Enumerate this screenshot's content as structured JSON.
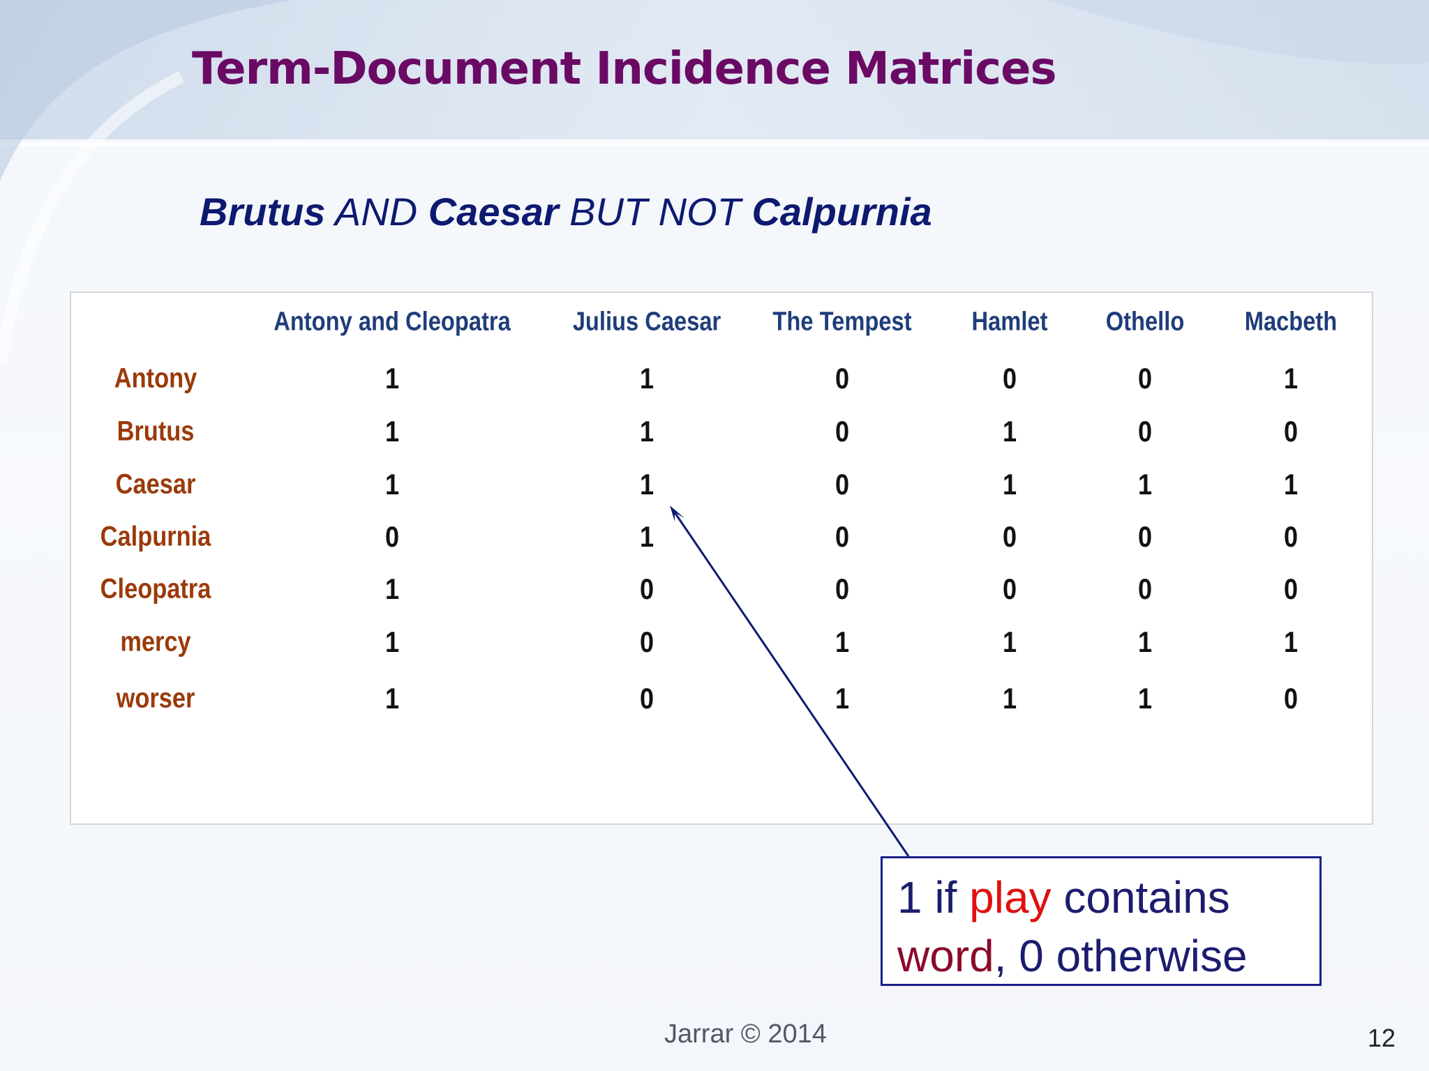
{
  "slide": {
    "title": "Term-Document Incidence Matrices",
    "query": {
      "parts": [
        {
          "text": "Brutus",
          "bold": true
        },
        {
          "text": " AND ",
          "bold": false
        },
        {
          "text": "Caesar",
          "bold": true
        },
        {
          "text": " BUT NOT ",
          "bold": false
        },
        {
          "text": "Calpurnia",
          "bold": true
        }
      ]
    },
    "matrix": {
      "columns": [
        "Antony and Cleopatra",
        "Julius Caesar",
        "The Tempest",
        "Hamlet",
        "Othello",
        "Macbeth"
      ],
      "rows": [
        {
          "term": "Antony",
          "values": [
            "1",
            "1",
            "0",
            "0",
            "0",
            "1"
          ]
        },
        {
          "term": "Brutus",
          "values": [
            "1",
            "1",
            "0",
            "1",
            "0",
            "0"
          ]
        },
        {
          "term": "Caesar",
          "values": [
            "1",
            "1",
            "0",
            "1",
            "1",
            "1"
          ]
        },
        {
          "term": "Calpurnia",
          "values": [
            "0",
            "1",
            "0",
            "0",
            "0",
            "0"
          ]
        },
        {
          "term": "Cleopatra",
          "values": [
            "1",
            "0",
            "0",
            "0",
            "0",
            "0"
          ]
        },
        {
          "term": "mercy",
          "values": [
            "1",
            "0",
            "1",
            "1",
            "1",
            "1"
          ]
        },
        {
          "term": "worser",
          "values": [
            "1",
            "0",
            "1",
            "1",
            "1",
            "0"
          ]
        }
      ]
    },
    "callout": {
      "line1_prefix": "1 if ",
      "line1_highlight": "play",
      "line1_suffix": " contains",
      "line2_highlight": "word",
      "line2_suffix": ", 0 otherwise"
    },
    "footer": "Jarrar © 2014",
    "page_number": "12"
  },
  "colors": {
    "title": "#6a0a64",
    "query": "#0d1a70",
    "column_header": "#1f3d7a",
    "row_label": "#9a3a0a",
    "callout_border": "#1a1f8a",
    "callout_play": "#e01010",
    "callout_word": "#8a0a2a"
  }
}
